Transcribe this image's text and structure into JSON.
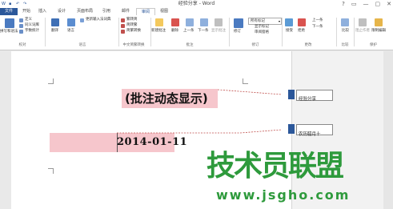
{
  "window": {
    "title": "经验分享 - Word",
    "controls": [
      "?",
      "▭",
      "—",
      "▢",
      "✕"
    ]
  },
  "tabs": [
    {
      "label": "文件"
    },
    {
      "label": "开始"
    },
    {
      "label": "插入"
    },
    {
      "label": "设计"
    },
    {
      "label": "页面布局"
    },
    {
      "label": "引用"
    },
    {
      "label": "邮件"
    },
    {
      "label": "审阅"
    },
    {
      "label": "视图"
    }
  ],
  "ribbon": {
    "proofing": {
      "label": "校对",
      "big_button": "拼写和语法",
      "items": [
        "定义",
        "同义词库",
        "字数统计"
      ]
    },
    "language": {
      "label": "语言",
      "translate": "翻译",
      "language": "语言",
      "update_ime": "更新输入法词典"
    },
    "chinese_conversion": {
      "label": "中文简繁转换",
      "items": [
        "繁转简",
        "简转繁",
        "简繁转换"
      ]
    },
    "comments": {
      "label": "批注",
      "new_comment": "新建批注",
      "delete": "删除",
      "previous": "上一条",
      "next": "下一条",
      "show_comments": "显示批注"
    },
    "tracking": {
      "label": "修订",
      "track_changes": "修订",
      "markup_select": "所有标记",
      "show_markup": "显示标记",
      "reviewing_pane": "审阅窗格"
    },
    "changes": {
      "label": "更改",
      "accept": "接受",
      "reject": "拒绝",
      "previous": "上一条",
      "next": "下一条"
    },
    "compare": {
      "label": "比较",
      "compare": "比较"
    },
    "protect": {
      "label": "保护",
      "block_authors": "阻止作者",
      "restrict_editing": "限制编辑"
    }
  },
  "document": {
    "line1": "(批注动态显示)",
    "line2": "2014-01-11"
  },
  "comments": [
    {
      "text": "经验分享"
    },
    {
      "text": "农历腊月十"
    }
  ],
  "watermark": {
    "text": "技术员联盟",
    "url": "www.jsgho.com"
  },
  "colors": {
    "accent": "#2b579a",
    "highlight": "#f6c6cc",
    "watermark": "#2e9a3c"
  }
}
